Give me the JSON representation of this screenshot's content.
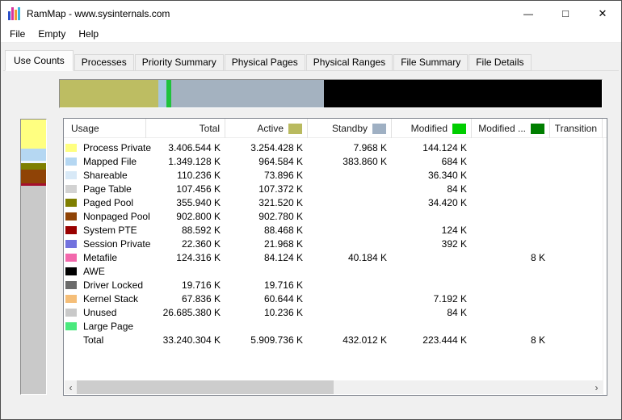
{
  "window": {
    "title": "RamMap - www.sysinternals.com",
    "icon_bar_colors": [
      "#2b4fc8",
      "#d8349e",
      "#ef9c34",
      "#35b3e0"
    ],
    "controls": {
      "minimize": "—",
      "maximize": "□",
      "close": "✕"
    }
  },
  "menu": {
    "items": [
      "File",
      "Empty",
      "Help"
    ]
  },
  "tabs": {
    "active_index": 0,
    "items": [
      "Use Counts",
      "Processes",
      "Priority Summary",
      "Physical Pages",
      "Physical Ranges",
      "File Summary",
      "File Details"
    ]
  },
  "memory_bar": {
    "segments": [
      {
        "name": "active",
        "color": "#bdbd62",
        "pct": 18.2
      },
      {
        "name": "standby-light",
        "color": "#a6c6de",
        "pct": 1.5
      },
      {
        "name": "modified",
        "color": "#1fc23c",
        "pct": 0.9
      },
      {
        "name": "standby",
        "color": "#a4b2c0",
        "pct": 28.1
      },
      {
        "name": "unused",
        "color": "#000000",
        "pct": 51.3
      }
    ]
  },
  "usage_bar": {
    "segments": [
      {
        "name": "process-private",
        "color": "#ffff80",
        "pct": 10.6
      },
      {
        "name": "mapped-file",
        "color": "#b5d7f2",
        "pct": 4.4
      },
      {
        "name": "shareable",
        "color": "#eef5fc",
        "pct": 0.9
      },
      {
        "name": "paged-pool",
        "color": "#7f7f00",
        "pct": 2.4
      },
      {
        "name": "nonpaged-pool",
        "color": "#8f4306",
        "pct": 5.0
      },
      {
        "name": "system-pte",
        "color": "#a50f2d",
        "pct": 0.9
      },
      {
        "name": "unused",
        "color": "#c9c9c9",
        "pct": 75.8
      }
    ]
  },
  "table": {
    "columns": [
      {
        "label": "Usage",
        "align": "left",
        "swatch": null
      },
      {
        "label": "Total",
        "align": "right",
        "swatch": null
      },
      {
        "label": "Active",
        "align": "right",
        "swatch": "#b9ba5f"
      },
      {
        "label": "Standby",
        "align": "right",
        "swatch": "#9fb0c3"
      },
      {
        "label": "Modified",
        "align": "right",
        "swatch": "#00ce00"
      },
      {
        "label": "Modified ...",
        "align": "right",
        "swatch": "#007e00"
      },
      {
        "label": "Transition",
        "align": "right",
        "swatch": null
      }
    ],
    "rows": [
      {
        "name": "Process Private",
        "swatch": "#ffff80",
        "values": [
          "3.406.544 K",
          "3.254.428 K",
          "7.968 K",
          "144.124 K",
          "",
          ""
        ]
      },
      {
        "name": "Mapped File",
        "swatch": "#b5d7f2",
        "values": [
          "1.349.128 K",
          "964.584 K",
          "383.860 K",
          "684 K",
          "",
          ""
        ]
      },
      {
        "name": "Shareable",
        "swatch": "#d8e9f7",
        "values": [
          "110.236 K",
          "73.896 K",
          "",
          "36.340 K",
          "",
          ""
        ]
      },
      {
        "name": "Page Table",
        "swatch": "#d2d2d2",
        "values": [
          "107.456 K",
          "107.372 K",
          "",
          "84 K",
          "",
          ""
        ]
      },
      {
        "name": "Paged Pool",
        "swatch": "#7f7f00",
        "values": [
          "355.940 K",
          "321.520 K",
          "",
          "34.420 K",
          "",
          ""
        ]
      },
      {
        "name": "Nonpaged Pool",
        "swatch": "#8f4306",
        "values": [
          "902.800 K",
          "902.780 K",
          "",
          "",
          "",
          ""
        ]
      },
      {
        "name": "System PTE",
        "swatch": "#990000",
        "values": [
          "88.592 K",
          "88.468 K",
          "",
          "124 K",
          "",
          ""
        ]
      },
      {
        "name": "Session Private",
        "swatch": "#7272de",
        "values": [
          "22.360 K",
          "21.968 K",
          "",
          "392 K",
          "",
          ""
        ]
      },
      {
        "name": "Metafile",
        "swatch": "#f268ac",
        "values": [
          "124.316 K",
          "84.124 K",
          "40.184 K",
          "",
          "8 K",
          ""
        ]
      },
      {
        "name": "AWE",
        "swatch": "#000000",
        "values": [
          "",
          "",
          "",
          "",
          "",
          ""
        ]
      },
      {
        "name": "Driver Locked",
        "swatch": "#6b6b6b",
        "values": [
          "19.716 K",
          "19.716 K",
          "",
          "",
          "",
          ""
        ]
      },
      {
        "name": "Kernel Stack",
        "swatch": "#f5be78",
        "values": [
          "67.836 K",
          "60.644 K",
          "",
          "7.192 K",
          "",
          ""
        ]
      },
      {
        "name": "Unused",
        "swatch": "#c9c9c9",
        "values": [
          "26.685.380 K",
          "10.236 K",
          "",
          "84 K",
          "",
          ""
        ]
      },
      {
        "name": "Large Page",
        "swatch": "#4ae97d",
        "values": [
          "",
          "",
          "",
          "",
          "",
          ""
        ]
      },
      {
        "name": "Total",
        "swatch": null,
        "values": [
          "33.240.304 K",
          "5.909.736 K",
          "432.012 K",
          "223.444 K",
          "8 K",
          ""
        ]
      }
    ]
  },
  "scrollbar": {
    "left_arrow": "‹",
    "right_arrow": "›"
  }
}
